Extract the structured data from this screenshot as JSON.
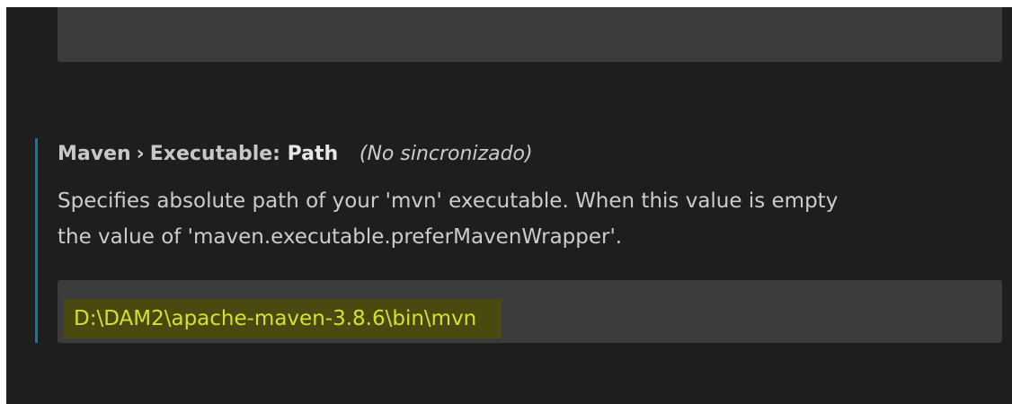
{
  "setting": {
    "category": "Maven",
    "separator": "›",
    "subcategory": "Executable:",
    "name": "Path",
    "sync_status": "(No sincronizado)",
    "description_line1": "Specifies absolute path of your 'mvn' executable. When this value is empty",
    "description_line2": "the value of 'maven.executable.preferMavenWrapper'.",
    "value": "D:\\DAM2\\apache-maven-3.8.6\\bin\\mvn"
  },
  "colors": {
    "background": "#1e1e1e",
    "input_background": "#3c3c3c",
    "modified_indicator": "#0c7d9d",
    "highlight_background": "#4a4a10",
    "highlight_text": "#d8e02c"
  }
}
